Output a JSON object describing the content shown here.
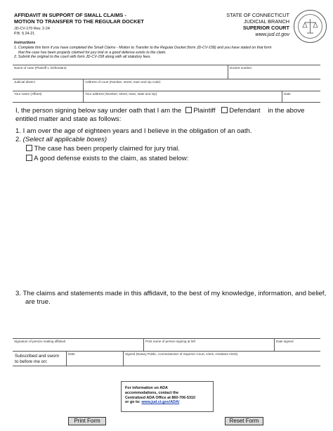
{
  "form": {
    "title_line1": "AFFIDAVIT IN SUPPORT OF SMALL CLAIMS -",
    "title_line2": "MOTION TO TRANSFER TO THE REGULAR DOCKET",
    "form_number": "JD-CV-170  Rev. 2-24",
    "statute": "P.B. § 24-21"
  },
  "court": {
    "line1": "STATE OF CONNECTICUT",
    "line2": "JUDICIAL BRANCH",
    "line3": "SUPERIOR COURT",
    "url": "www.jud.ct.gov"
  },
  "instructions": {
    "heading": "Instructions",
    "item1_a": "1. Complete this form if you have completed the Small Claims - Motion to Transfer to the Regular Docket (form JD-CV-158) and you have stated on that form",
    "item1_b": "that the case has been properly claimed for jury trial or a good defense exists to the claim.",
    "item2": "2. Submit the original to the court with form JD-CV-158 along with all statutory fees."
  },
  "fields": {
    "name_of_case": "Name of case (Plaintiff v. Defendant)",
    "docket_number": "Docket number",
    "judicial_district": "Judicial district",
    "address_of_court": "Address of court (Number, street, town and zip code)",
    "your_name": "Your name (Affiant)",
    "your_address": "Your address (Number, street, town, state and zip)",
    "date": "Date"
  },
  "statement": {
    "intro_a": "I, the person signing below say under oath that I am the",
    "plaintiff": "Plaintiff",
    "defendant": "Defendant",
    "intro_b": "in the above",
    "intro_c": "entitled matter and state as follows:",
    "item1": "1.  I am over the age of eighteen years and I believe in the obligation of an oath.",
    "item2_num": "2.  ",
    "item2": "(Select all applicable boxes)",
    "opt_jury": "The case has been properly claimed for jury trial.",
    "opt_defense": "A good defense exists to the claim, as stated below:",
    "item3_a": "3.  The claims and statements made in this affidavit, to the best of my knowledge, information, and belief,",
    "item3_b": "are true."
  },
  "signature": {
    "sig_label": "Signature of person making affidavit",
    "print_label": "Print name of person signing at left",
    "date_signed": "Date signed",
    "subscribed_a": "Subscribed and sworn",
    "subscribed_b": "to before me on:",
    "date": "Date",
    "signed_label": "Signed (Notary Public, Commissioner of Superior Court, Clerk, Assistant Clerk)"
  },
  "ada": {
    "line1": "For information on ADA",
    "line2": "accommodations, contact the",
    "line3": "Centralized ADA Office at 860-706-5310",
    "line4_prefix": "or go to: ",
    "line4_link": "www.jud.ct.gov/ADA/"
  },
  "buttons": {
    "print": "Print Form",
    "reset": "Reset Form"
  }
}
